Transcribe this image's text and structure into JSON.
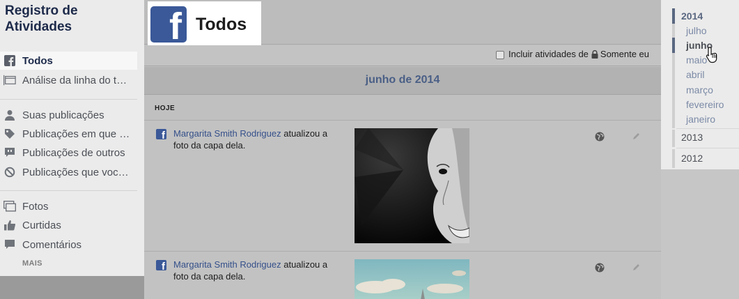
{
  "sidebar": {
    "title_line1": "Registro de",
    "title_line2": "Atividades",
    "group1": [
      {
        "label": "Todos",
        "icon": "facebook-icon"
      },
      {
        "label": "Análise da linha do t…",
        "icon": "timeline-review-icon"
      }
    ],
    "group2": [
      {
        "label": "Suas publicações",
        "icon": "person-icon"
      },
      {
        "label": "Publicações em que …",
        "icon": "tag-icon"
      },
      {
        "label": "Publicações de outros",
        "icon": "comment-quote-icon"
      },
      {
        "label": "Publicações que voc…",
        "icon": "hidden-icon"
      }
    ],
    "group3": [
      {
        "label": "Fotos",
        "icon": "photos-icon"
      },
      {
        "label": "Curtidas",
        "icon": "like-icon"
      },
      {
        "label": "Comentários",
        "icon": "comment-icon"
      }
    ],
    "more_label": "MAIS"
  },
  "header": {
    "title": "Todos",
    "logo_letter": "f"
  },
  "filter": {
    "text_before": "Incluir atividades de",
    "text_after": "Somente eu",
    "checked": false
  },
  "feed": {
    "month_heading": "junho de 2014",
    "section_label": "HOJE",
    "activities": [
      {
        "actor": "Margarita Smith Rodriguez",
        "action_part1": " atualizou a",
        "action_part2": "foto da capa dela."
      },
      {
        "actor": "Margarita Smith Rodriguez",
        "action_part1": " atualizou a",
        "action_part2": "foto da capa dela."
      }
    ]
  },
  "timeline": {
    "years": [
      "2014",
      "2013",
      "2012"
    ],
    "active_year": "2014",
    "months": [
      "julho",
      "junho",
      "maio",
      "abril",
      "março",
      "fevereiro",
      "janeiro"
    ],
    "active_month": "junho"
  },
  "colors": {
    "facebook_blue": "#3b5998",
    "link_blue": "#35508a",
    "month_heading": "#4a5f86",
    "timeline_accent": "#596780"
  }
}
